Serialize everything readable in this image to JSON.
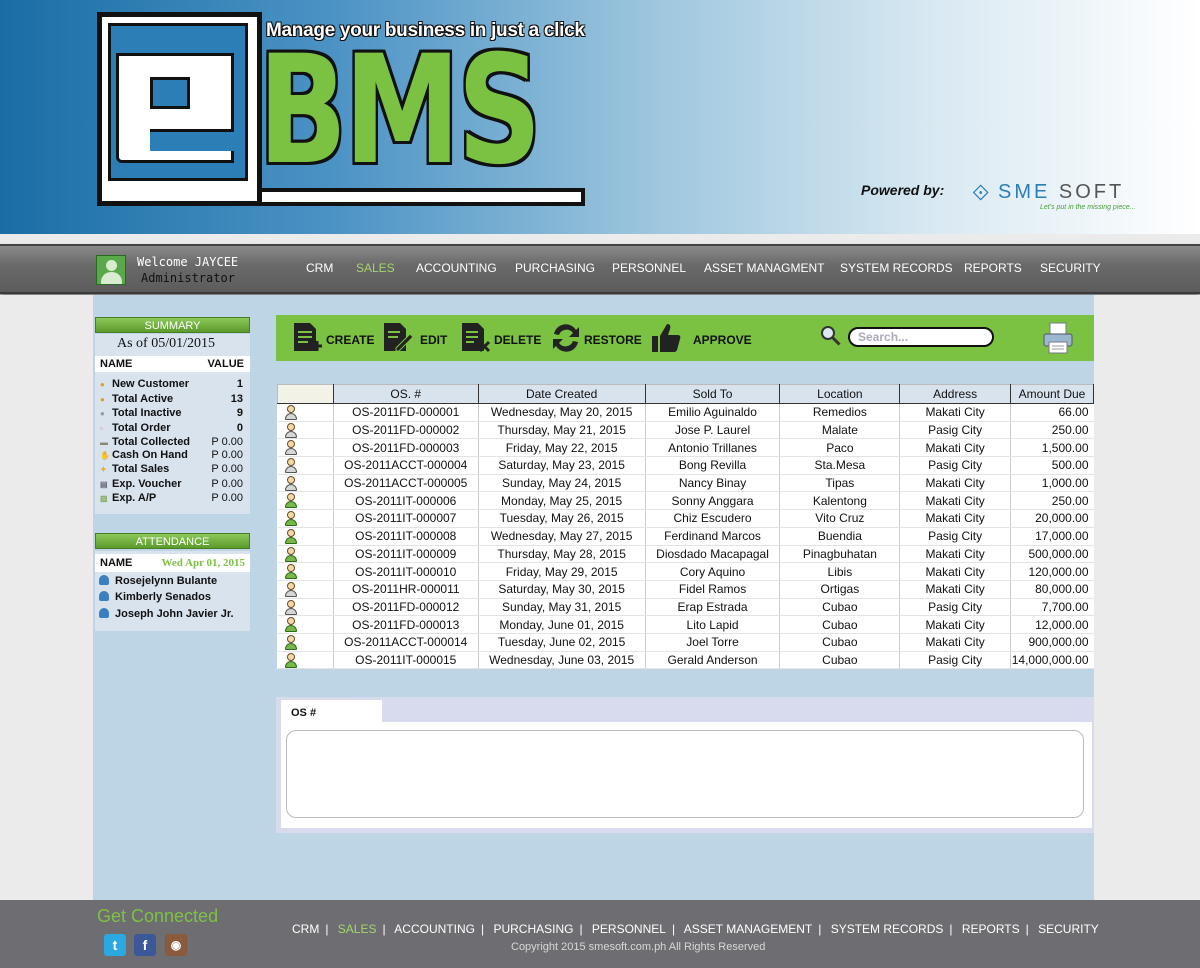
{
  "header": {
    "tagline": "Manage your business in just a click",
    "logo_text": "BMS",
    "powered_by": "Powered by:",
    "sme_name_a": "SME",
    "sme_name_b": " SOFT",
    "sme_slogan": "Let's put in the missing piece..."
  },
  "user": {
    "welcome": "Welcome JAYCEE",
    "role": "Administrator"
  },
  "nav": {
    "items": [
      "CRM",
      "SALES",
      "ACCOUNTING",
      "PURCHASING",
      "PERSONNEL",
      "ASSET MANAGMENT",
      "SYSTEM RECORDS",
      "REPORTS",
      "SECURITY"
    ],
    "active": "SALES"
  },
  "summary": {
    "title": "SUMMARY",
    "as_of": "As of 05/01/2015",
    "col_name": "NAME",
    "col_value": "VALUE",
    "rows": [
      {
        "label": "New Customer",
        "value": "1"
      },
      {
        "label": "Total Active",
        "value": "13"
      },
      {
        "label": "Total Inactive",
        "value": "9"
      },
      {
        "label": "Total Order",
        "value": "0"
      },
      {
        "label": "Total Collected",
        "value": "P 0.00"
      },
      {
        "label": "Cash On Hand",
        "value": "P 0.00"
      },
      {
        "label": "Total Sales",
        "value": "P 0.00"
      },
      {
        "label": "Exp. Voucher",
        "value": "P 0.00"
      },
      {
        "label": "Exp. A/P",
        "value": "P 0.00"
      }
    ]
  },
  "attendance": {
    "title": "ATTENDANCE",
    "col_name": "NAME",
    "date": "Wed Apr 01, 2015",
    "people": [
      "Rosejelynn Bulante",
      "Kimberly Senados",
      "Joseph John Javier Jr."
    ]
  },
  "toolbar": {
    "create": "CREATE",
    "edit": "EDIT",
    "delete": "DELETE",
    "restore": "RESTORE",
    "approve": "APPROVE",
    "search_placeholder": "Search..."
  },
  "table": {
    "columns": [
      "OS. #",
      "Date Created",
      "Sold To",
      "Location",
      "Address",
      "Amount Due"
    ],
    "rows": [
      {
        "icon": "gray",
        "os": "OS-2011FD-000001",
        "date": "Wednesday, May 20, 2015",
        "sold_to": "Emilio Aguinaldo",
        "location": "Remedios",
        "address": "Makati City",
        "amount": "66.00"
      },
      {
        "icon": "gray",
        "os": "OS-2011FD-000002",
        "date": "Thursday, May 21, 2015",
        "sold_to": "Jose P. Laurel",
        "location": "Malate",
        "address": "Pasig City",
        "amount": "250.00"
      },
      {
        "icon": "gray",
        "os": "OS-2011FD-000003",
        "date": "Friday, May 22, 2015",
        "sold_to": "Antonio Trillanes",
        "location": "Paco",
        "address": "Makati City",
        "amount": "1,500.00"
      },
      {
        "icon": "gray",
        "os": "OS-2011ACCT-000004",
        "date": "Saturday, May 23, 2015",
        "sold_to": "Bong Revilla",
        "location": "Sta.Mesa",
        "address": "Pasig City",
        "amount": "500.00"
      },
      {
        "icon": "gray",
        "os": "OS-2011ACCT-000005",
        "date": "Sunday, May 24, 2015",
        "sold_to": "Nancy Binay",
        "location": "Tipas",
        "address": "Makati City",
        "amount": "1,000.00"
      },
      {
        "icon": "green",
        "os": "OS-2011IT-000006",
        "date": "Monday, May 25, 2015",
        "sold_to": "Sonny Anggara",
        "location": "Kalentong",
        "address": "Makati City",
        "amount": "250.00"
      },
      {
        "icon": "green",
        "os": "OS-2011IT-000007",
        "date": "Tuesday, May 26, 2015",
        "sold_to": "Chiz Escudero",
        "location": "Vito Cruz",
        "address": "Makati City",
        "amount": "20,000.00"
      },
      {
        "icon": "green",
        "os": "OS-2011IT-000008",
        "date": "Wednesday, May 27, 2015",
        "sold_to": "Ferdinand Marcos",
        "location": "Buendia",
        "address": "Pasig City",
        "amount": "17,000.00"
      },
      {
        "icon": "green",
        "os": "OS-2011IT-000009",
        "date": "Thursday, May 28, 2015",
        "sold_to": "Diosdado Macapagal",
        "location": "Pinagbuhatan",
        "address": "Makati City",
        "amount": "500,000.00"
      },
      {
        "icon": "green",
        "os": "OS-2011IT-000010",
        "date": "Friday, May 29, 2015",
        "sold_to": "Cory Aquino",
        "location": "Libis",
        "address": "Makati City",
        "amount": "120,000.00"
      },
      {
        "icon": "gray",
        "os": "OS-2011HR-000011",
        "date": "Saturday, May 30, 2015",
        "sold_to": "Fidel Ramos",
        "location": "Ortigas",
        "address": "Makati City",
        "amount": "80,000.00"
      },
      {
        "icon": "gray",
        "os": "OS-2011FD-000012",
        "date": "Sunday, May 31, 2015",
        "sold_to": "Erap Estrada",
        "location": "Cubao",
        "address": "Pasig City",
        "amount": "7,700.00"
      },
      {
        "icon": "green",
        "os": "OS-2011FD-000013",
        "date": "Monday, June 01, 2015",
        "sold_to": "Lito Lapid",
        "location": "Cubao",
        "address": "Makati City",
        "amount": "12,000.00"
      },
      {
        "icon": "green",
        "os": "OS-2011ACCT-000014",
        "date": "Tuesday, June 02, 2015",
        "sold_to": "Joel Torre",
        "location": "Cubao",
        "address": "Makati City",
        "amount": "900,000.00"
      },
      {
        "icon": "green",
        "os": "OS-2011IT-000015",
        "date": "Wednesday, June 03, 2015",
        "sold_to": "Gerald Anderson",
        "location": "Cubao",
        "address": "Pasig City",
        "amount": "14,000,000.00"
      }
    ]
  },
  "detail": {
    "tab_label": "OS #"
  },
  "footer": {
    "get_connected": "Get Connected",
    "nav": [
      "CRM",
      "SALES",
      "ACCOUNTING",
      "PURCHASING",
      "PERSONNEL",
      "ASSET MANAGEMENT",
      "SYSTEM RECORDS",
      "REPORTS",
      "SECURITY"
    ],
    "active": "SALES",
    "copyright": "Copyright 2015  smesoft.com.ph  All Rights Reserved"
  },
  "colors": {
    "brand_green": "#7cc242",
    "brand_blue": "#2b7fb6",
    "nav_gray": "#6a6a6a"
  }
}
